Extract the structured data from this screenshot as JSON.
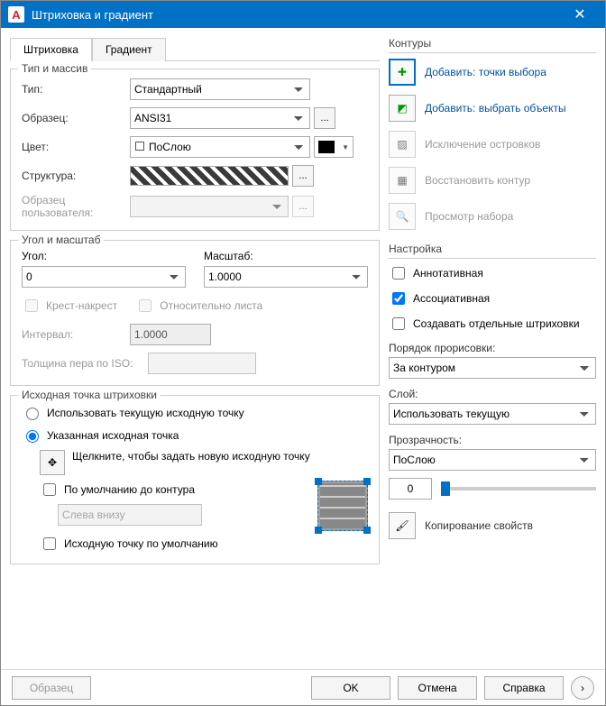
{
  "window": {
    "title": "Штриховка и градиент"
  },
  "tabs": {
    "hatch": "Штриховка",
    "gradient": "Градиент"
  },
  "type_group": {
    "title": "Тип и массив",
    "type_label": "Тип:",
    "type_value": "Стандартный",
    "pattern_label": "Образец:",
    "pattern_value": "ANSI31",
    "color_label": "Цвет:",
    "color_value": "ПоСлою",
    "swatch_label": "Структура:",
    "custom_label": "Образец пользователя:"
  },
  "angle_group": {
    "title": "Угол и масштаб",
    "angle_label": "Угол:",
    "angle_value": "0",
    "scale_label": "Масштаб:",
    "scale_value": "1.0000",
    "double_label": "Крест-накрест",
    "paper_label": "Относительно листа",
    "spacing_label": "Интервал:",
    "spacing_value": "1.0000",
    "iso_label": "Толщина пера по ISO:"
  },
  "origin_group": {
    "title": "Исходная точка штриховки",
    "use_current": "Использовать текущую исходную точку",
    "specified": "Указанная исходная точка",
    "click_hint": "Щелкните, чтобы задать новую исходную точку",
    "default_boundary": "По умолчанию до контура",
    "bl_value": "Слева внизу",
    "store_default": "Исходную точку по умолчанию"
  },
  "boundaries": {
    "title": "Контуры",
    "pick_points": "Добавить: точки выбора",
    "select_objects": "Добавить: выбрать объекты",
    "remove_islands": "Исключение островков",
    "recreate": "Восстановить контур",
    "view_sel": "Просмотр набора"
  },
  "options": {
    "title": "Настройка",
    "annotative": "Аннотативная",
    "associative": "Ассоциативная",
    "separate": "Создавать отдельные штриховки",
    "draw_order_label": "Порядок прорисовки:",
    "draw_order_value": "За контуром",
    "layer_label": "Слой:",
    "layer_value": "Использовать текущую",
    "transparency_label": "Прозрачность:",
    "transparency_value": "ПоСлою",
    "transparency_num": "0",
    "inherit": "Копирование свойств"
  },
  "footer": {
    "preview": "Образец",
    "ok": "OK",
    "cancel": "Отмена",
    "help": "Справка"
  }
}
